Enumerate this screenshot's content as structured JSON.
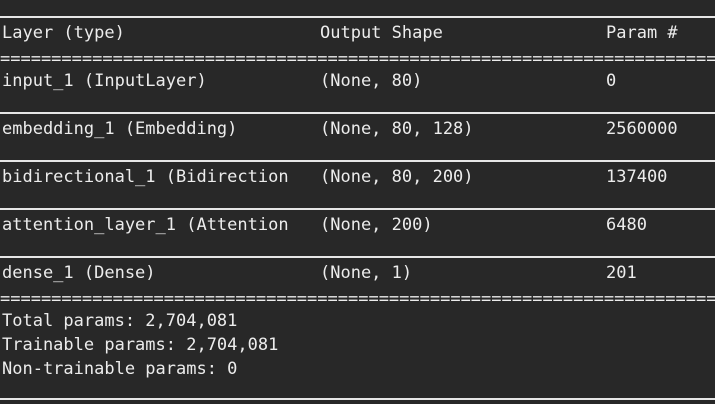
{
  "header": {
    "layer_col": "Layer (type)",
    "shape_col": "Output Shape",
    "param_col": "Param #"
  },
  "separator_eq": "=====================================================================================================================",
  "rows": [
    {
      "layer": "input_1 (InputLayer)",
      "shape": "(None, 80)",
      "params": "0"
    },
    {
      "layer": "embedding_1 (Embedding)",
      "shape": "(None, 80, 128)",
      "params": "2560000"
    },
    {
      "layer": "bidirectional_1 (Bidirection",
      "shape": "(None, 80, 200)",
      "params": "137400"
    },
    {
      "layer": "attention_layer_1 (Attention",
      "shape": "(None, 200)",
      "params": "6480"
    },
    {
      "layer": "dense_1 (Dense)",
      "shape": "(None, 1)",
      "params": "201"
    }
  ],
  "summary": {
    "total": "Total params: 2,704,081",
    "trainable": "Trainable params: 2,704,081",
    "non_trainable": "Non-trainable params: 0"
  },
  "colors": {
    "background": "#282828",
    "text": "#ececec"
  }
}
